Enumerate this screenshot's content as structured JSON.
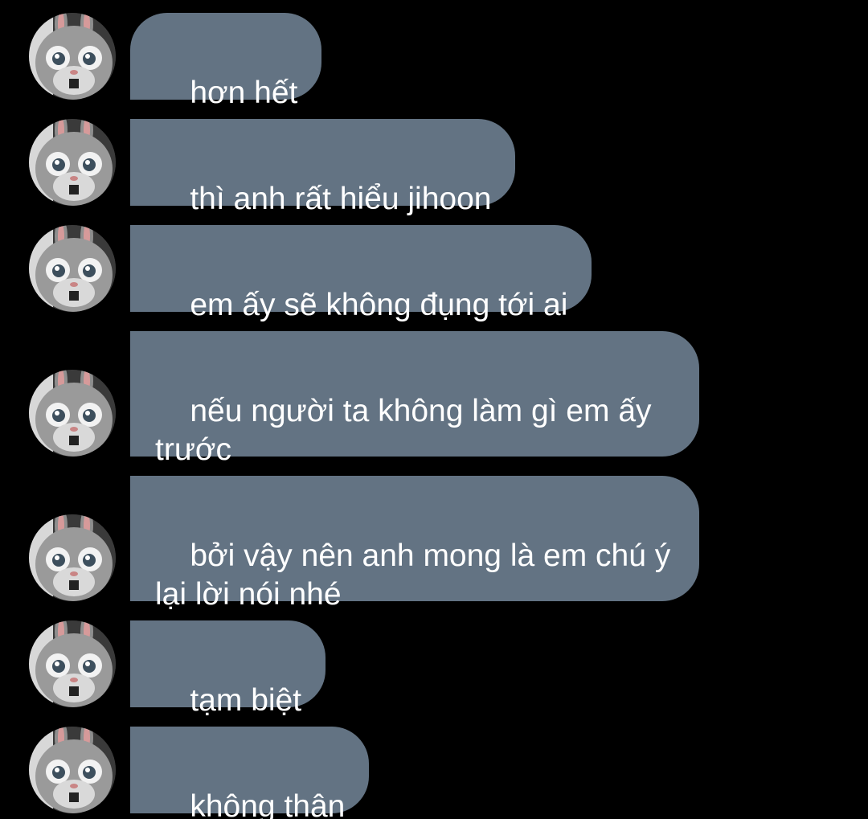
{
  "colors": {
    "background": "#000000",
    "bubble": "#637383",
    "text": "#ffffff"
  },
  "avatar_icon": "bunny-mascot-avatar",
  "messages": [
    {
      "text": "hơn hết"
    },
    {
      "text": "thì anh rất hiểu jihoon"
    },
    {
      "text": "em ấy sẽ không đụng tới ai"
    },
    {
      "text": "nếu người ta không làm gì em ấy\ntrước"
    },
    {
      "text": "bởi vậy nên anh mong là em chú ý\nlại lời nói nhé"
    },
    {
      "text": "tạm biệt"
    },
    {
      "text": "không thân"
    }
  ]
}
